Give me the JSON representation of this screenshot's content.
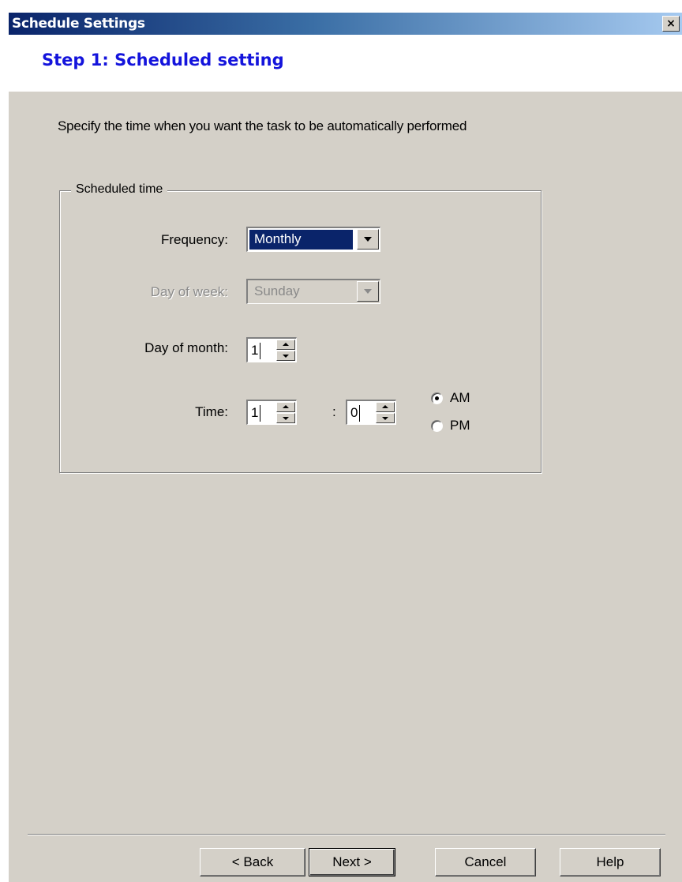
{
  "window": {
    "title": "Schedule Settings",
    "close_label": "×"
  },
  "header": {
    "step_title": "Step 1: Scheduled setting"
  },
  "instruction": "Specify the time when you want the task to be automatically performed",
  "group": {
    "title": "Scheduled time",
    "frequency": {
      "label": "Frequency:",
      "value": "Monthly",
      "selected": true
    },
    "day_of_week": {
      "label": "Day of week:",
      "value": "Sunday",
      "enabled": false
    },
    "day_of_month": {
      "label": "Day of month:",
      "value": "1"
    },
    "time": {
      "label": "Time:",
      "hour": "1",
      "separator": ":",
      "minute": "0",
      "am_label": "AM",
      "pm_label": "PM",
      "am_selected": true
    }
  },
  "buttons": {
    "back": "< Back",
    "next": "Next >",
    "cancel": "Cancel",
    "help": "Help"
  }
}
